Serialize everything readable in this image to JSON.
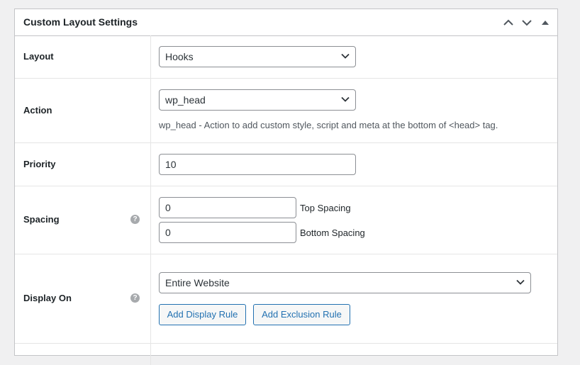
{
  "panel": {
    "title": "Custom Layout Settings"
  },
  "rows": {
    "layout": {
      "label": "Layout",
      "value": "Hooks"
    },
    "action": {
      "label": "Action",
      "value": "wp_head",
      "description": "wp_head - Action to add custom style, script and meta at the bottom of <head> tag."
    },
    "priority": {
      "label": "Priority",
      "value": "10"
    },
    "spacing": {
      "label": "Spacing",
      "help": "?",
      "top_value": "0",
      "top_label": "Top Spacing",
      "bottom_value": "0",
      "bottom_label": "Bottom Spacing"
    },
    "display_on": {
      "label": "Display On",
      "help": "?",
      "value": "Entire Website",
      "add_display_rule": "Add Display Rule",
      "add_exclusion_rule": "Add Exclusion Rule"
    }
  },
  "colors": {
    "accent": "#2271b1",
    "border": "#c3c4c7",
    "background": "#f0f0f1"
  }
}
